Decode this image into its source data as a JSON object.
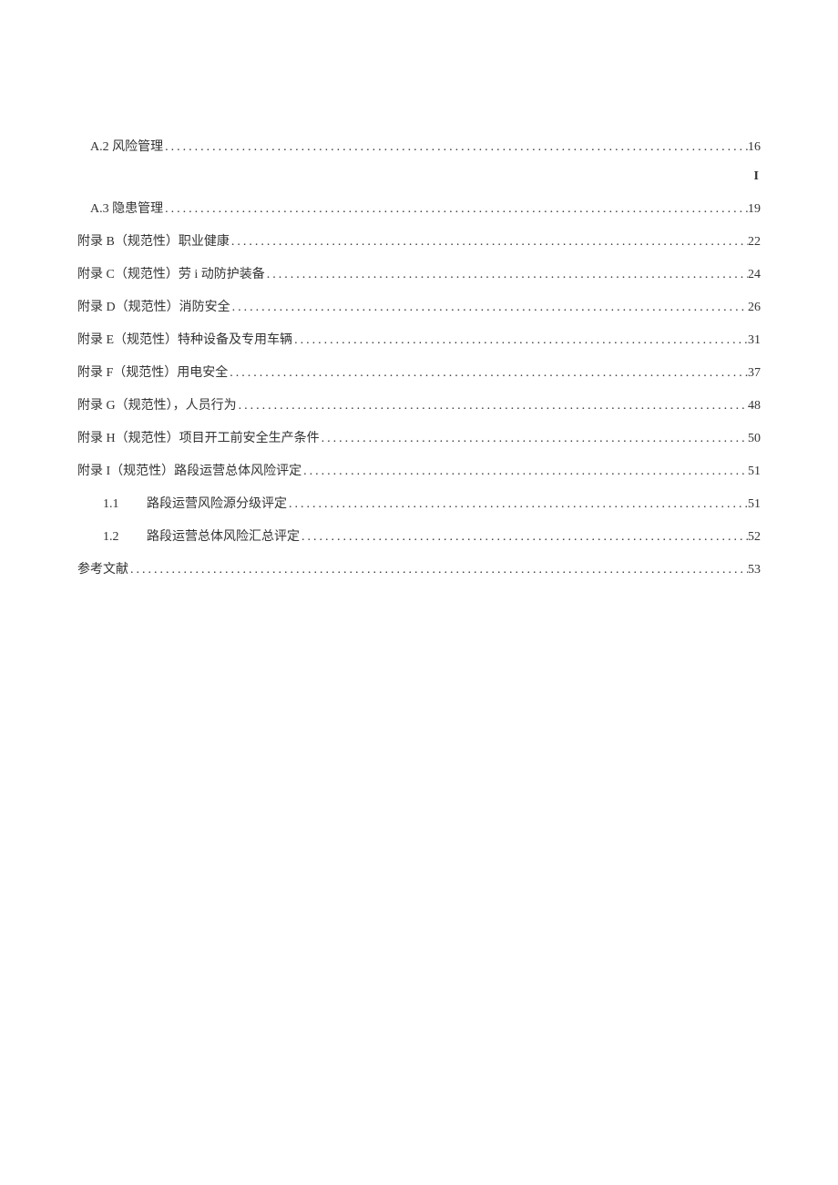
{
  "roman_marker": "I",
  "entries": [
    {
      "indent": 1,
      "label": "A.2 风险管理",
      "page": "16",
      "has_roman_after": true
    },
    {
      "indent": 1,
      "label": "A.3 隐患管理 ",
      "page": "19"
    },
    {
      "indent": 0,
      "label": "附录 B（规范性）职业健康 ",
      "page": "22"
    },
    {
      "indent": 0,
      "label": "附录 C（规范性）劳 i 动防护装备 ",
      "page": "24"
    },
    {
      "indent": 0,
      "label": "附录 D（规范性）消防安全 ",
      "page": "26"
    },
    {
      "indent": 0,
      "label": "附录 E（规范性）特种设备及专用车辆",
      "page": "31"
    },
    {
      "indent": 0,
      "label": "附录 F（规范性）用电安全 ",
      "page": "37"
    },
    {
      "indent": 0,
      "label": "附录 G（规范性），人员行为 ",
      "page": "48"
    },
    {
      "indent": 0,
      "label": "附录 H（规范性）项目开工前安全生产条件 ",
      "page": "50"
    },
    {
      "indent": 0,
      "label": "附录 I（规范性）路段运营总体风险评定 ",
      "page": "51"
    },
    {
      "indent": 2,
      "num": "1.1",
      "label": "路段运营风险源分级评定",
      "page": "51"
    },
    {
      "indent": 2,
      "num": "1.2",
      "label": "路段运营总体风险汇总评定 ",
      "page": "52"
    },
    {
      "indent": 0,
      "label": "参考文献 ",
      "page": "53"
    }
  ]
}
